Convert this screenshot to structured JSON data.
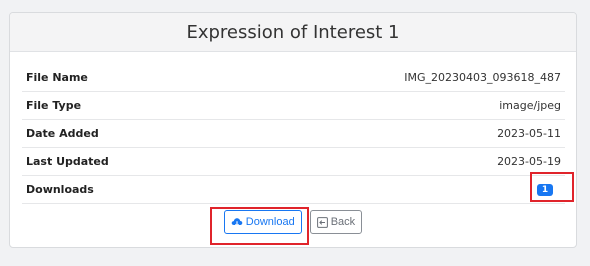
{
  "card": {
    "title": "Expression of Interest 1"
  },
  "details": [
    {
      "label": "File Name",
      "value": "IMG_20230403_093618_487"
    },
    {
      "label": "File Type",
      "value": "image/jpeg"
    },
    {
      "label": "Date Added",
      "value": "2023-05-11"
    },
    {
      "label": "Last Updated",
      "value": "2023-05-19"
    },
    {
      "label": "Downloads",
      "value": "1"
    }
  ],
  "actions": {
    "download_label": "Download",
    "back_label": "Back",
    "download_icon": "cloud-download-icon",
    "back_icon": "arrow-left-box-icon"
  },
  "colors": {
    "accent": "#1877f2",
    "highlight": "#e0242b"
  }
}
